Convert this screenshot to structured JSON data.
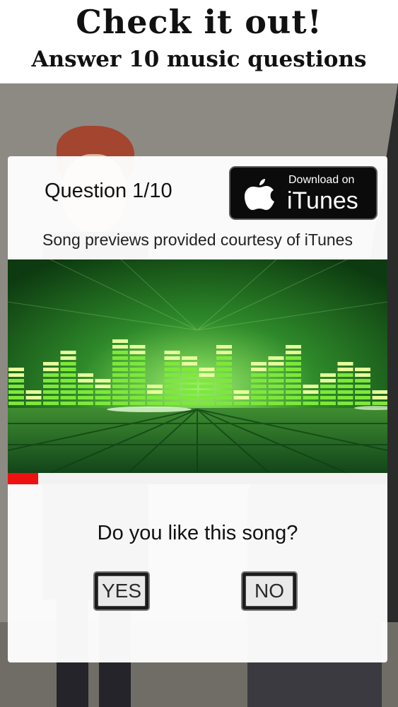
{
  "header": {
    "title": "Check it out!",
    "subtitle": "Answer 10 music questions"
  },
  "card": {
    "question_label": "Question 1/10",
    "itunes_badge": {
      "small_text": "Download on",
      "big_text": "iTunes",
      "icon": "apple-icon"
    },
    "courtesy_text": "Song previews provided courtesy of iTunes",
    "preview_image": "equalizer-visual",
    "progress": 0.08,
    "prompt": "Do you like this song?",
    "yes_label": "YES",
    "no_label": "NO"
  },
  "colors": {
    "progress": "#ee1111",
    "equalizer_green": "#7ee83a",
    "badge_bg": "#0b0b0b"
  }
}
